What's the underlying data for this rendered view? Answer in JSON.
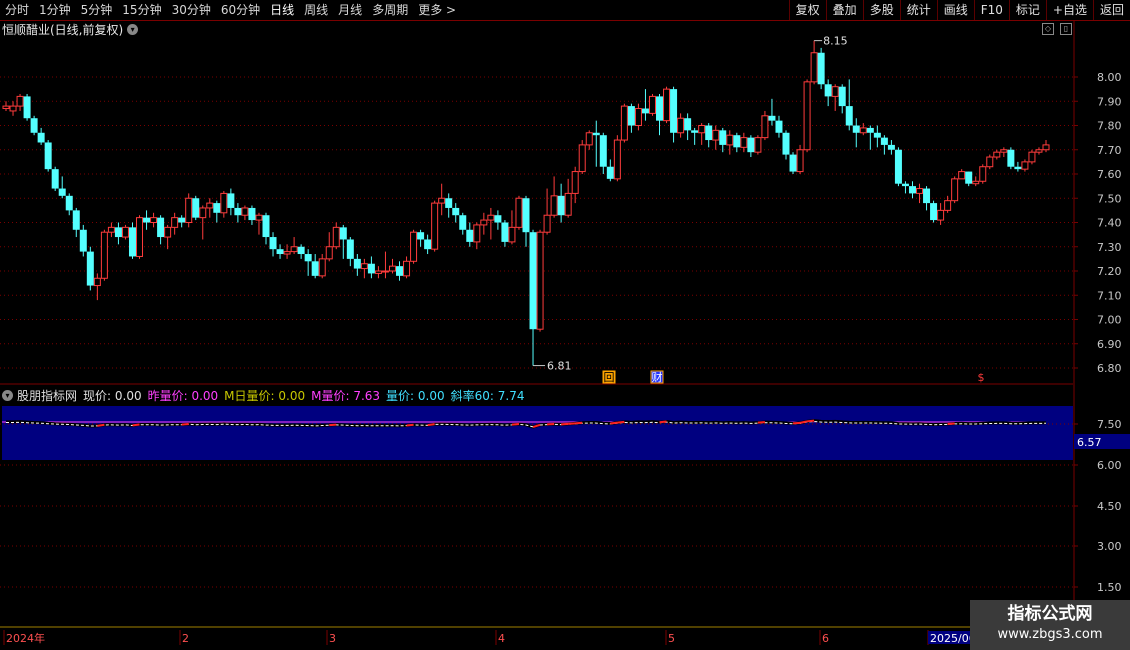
{
  "toolbar": {
    "periods": [
      "分时",
      "1分钟",
      "5分钟",
      "15分钟",
      "30分钟",
      "60分钟",
      "日线",
      "周线",
      "月线",
      "多周期",
      "更多 >"
    ],
    "active_period": "日线",
    "actions": [
      "复权",
      "叠加",
      "多股",
      "统计",
      "画线",
      "F10",
      "标记",
      "+自选",
      "返回"
    ]
  },
  "stock_title": "恒顺醋业(日线,前复权)",
  "main_chart": {
    "high_label": "8.15",
    "low_label": "6.81",
    "y_ticks": [
      "8.00",
      "7.90",
      "7.80",
      "7.70",
      "7.60",
      "7.50",
      "7.40",
      "7.30",
      "7.20",
      "7.10",
      "7.00",
      "6.90",
      "6.80"
    ],
    "markers": [
      "回",
      "财",
      "$"
    ]
  },
  "indicator": {
    "name": "股朋指标网",
    "fields": [
      {
        "label": "现价: 0.00",
        "color": "#e0e0e0"
      },
      {
        "label": "昨量价: 0.00",
        "color": "#ff40ff"
      },
      {
        "label": "M日量价: 0.00",
        "color": "#c8c800"
      },
      {
        "label": "M量价: 7.63",
        "color": "#ff40ff"
      },
      {
        "label": "量价: 0.00",
        "color": "#40e0ff"
      },
      {
        "label": "斜率60: 7.74",
        "color": "#40e0ff"
      }
    ],
    "y_ticks": [
      "7.50",
      "6.00",
      "4.50",
      "3.00",
      "1.50"
    ],
    "current_value": "6.57"
  },
  "x_axis": {
    "labels": [
      "2024年",
      "2",
      "3",
      "4",
      "5",
      "6",
      "2025/06"
    ]
  },
  "watermark": {
    "line1": "指标公式网",
    "line2": "www.zbgs3.com"
  },
  "colors": {
    "up": "#ff3c3c",
    "down": "#54ffff",
    "grid": "#7a0000",
    "panel_bg": "#000080"
  },
  "chart_data": {
    "type": "candlestick",
    "candles": [
      [
        7.87,
        7.88,
        7.86,
        7.9
      ],
      [
        7.86,
        7.88,
        7.84,
        7.9
      ],
      [
        7.88,
        7.92,
        7.86,
        7.93
      ],
      [
        7.92,
        7.83,
        7.82,
        7.93
      ],
      [
        7.83,
        7.77,
        7.76,
        7.84
      ],
      [
        7.77,
        7.73,
        7.72,
        7.79
      ],
      [
        7.73,
        7.62,
        7.61,
        7.74
      ],
      [
        7.62,
        7.54,
        7.53,
        7.63
      ],
      [
        7.54,
        7.51,
        7.5,
        7.59
      ],
      [
        7.51,
        7.45,
        7.43,
        7.52
      ],
      [
        7.45,
        7.37,
        7.34,
        7.46
      ],
      [
        7.37,
        7.28,
        7.26,
        7.39
      ],
      [
        7.28,
        7.14,
        7.12,
        7.3
      ],
      [
        7.14,
        7.17,
        7.08,
        7.19
      ],
      [
        7.17,
        7.36,
        7.16,
        7.37
      ],
      [
        7.36,
        7.38,
        7.34,
        7.4
      ],
      [
        7.38,
        7.34,
        7.31,
        7.4
      ],
      [
        7.34,
        7.38,
        7.33,
        7.39
      ],
      [
        7.38,
        7.26,
        7.25,
        7.4
      ],
      [
        7.26,
        7.42,
        7.25,
        7.43
      ],
      [
        7.42,
        7.4,
        7.37,
        7.45
      ],
      [
        7.4,
        7.42,
        7.38,
        7.44
      ],
      [
        7.42,
        7.34,
        7.31,
        7.43
      ],
      [
        7.34,
        7.38,
        7.29,
        7.39
      ],
      [
        7.38,
        7.42,
        7.35,
        7.44
      ],
      [
        7.42,
        7.4,
        7.38,
        7.43
      ],
      [
        7.4,
        7.5,
        7.38,
        7.52
      ],
      [
        7.5,
        7.42,
        7.41,
        7.51
      ],
      [
        7.42,
        7.46,
        7.33,
        7.47
      ],
      [
        7.46,
        7.48,
        7.42,
        7.5
      ],
      [
        7.48,
        7.44,
        7.4,
        7.49
      ],
      [
        7.44,
        7.52,
        7.42,
        7.53
      ],
      [
        7.52,
        7.46,
        7.43,
        7.54
      ],
      [
        7.46,
        7.43,
        7.4,
        7.48
      ],
      [
        7.43,
        7.46,
        7.41,
        7.47
      ],
      [
        7.46,
        7.41,
        7.39,
        7.47
      ],
      [
        7.41,
        7.43,
        7.35,
        7.44
      ],
      [
        7.43,
        7.34,
        7.31,
        7.44
      ],
      [
        7.34,
        7.29,
        7.26,
        7.36
      ],
      [
        7.29,
        7.27,
        7.25,
        7.31
      ],
      [
        7.27,
        7.28,
        7.25,
        7.31
      ],
      [
        7.28,
        7.3,
        7.27,
        7.34
      ],
      [
        7.3,
        7.27,
        7.25,
        7.31
      ],
      [
        7.27,
        7.24,
        7.18,
        7.29
      ],
      [
        7.24,
        7.18,
        7.17,
        7.27
      ],
      [
        7.18,
        7.25,
        7.17,
        7.27
      ],
      [
        7.25,
        7.3,
        7.24,
        7.36
      ],
      [
        7.3,
        7.38,
        7.29,
        7.4
      ],
      [
        7.38,
        7.33,
        7.25,
        7.39
      ],
      [
        7.33,
        7.25,
        7.22,
        7.34
      ],
      [
        7.25,
        7.21,
        7.18,
        7.27
      ],
      [
        7.21,
        7.23,
        7.17,
        7.25
      ],
      [
        7.23,
        7.19,
        7.17,
        7.26
      ],
      [
        7.19,
        7.2,
        7.17,
        7.22
      ],
      [
        7.2,
        7.2,
        7.17,
        7.28
      ],
      [
        7.2,
        7.22,
        7.19,
        7.25
      ],
      [
        7.22,
        7.18,
        7.16,
        7.24
      ],
      [
        7.18,
        7.24,
        7.17,
        7.26
      ],
      [
        7.24,
        7.36,
        7.23,
        7.37
      ],
      [
        7.36,
        7.33,
        7.3,
        7.37
      ],
      [
        7.33,
        7.29,
        7.27,
        7.35
      ],
      [
        7.29,
        7.48,
        7.28,
        7.49
      ],
      [
        7.48,
        7.5,
        7.43,
        7.56
      ],
      [
        7.5,
        7.46,
        7.42,
        7.52
      ],
      [
        7.46,
        7.43,
        7.4,
        7.48
      ],
      [
        7.43,
        7.37,
        7.35,
        7.44
      ],
      [
        7.37,
        7.32,
        7.3,
        7.4
      ],
      [
        7.32,
        7.39,
        7.29,
        7.4
      ],
      [
        7.39,
        7.41,
        7.35,
        7.44
      ],
      [
        7.41,
        7.43,
        7.33,
        7.46
      ],
      [
        7.43,
        7.4,
        7.37,
        7.45
      ],
      [
        7.4,
        7.32,
        7.3,
        7.41
      ],
      [
        7.32,
        7.38,
        7.31,
        7.45
      ],
      [
        7.38,
        7.5,
        7.37,
        7.51
      ],
      [
        7.5,
        7.36,
        7.3,
        7.51
      ],
      [
        7.36,
        6.96,
        6.81,
        7.37
      ],
      [
        6.96,
        7.36,
        6.95,
        7.37
      ],
      [
        7.36,
        7.43,
        7.35,
        7.54
      ],
      [
        7.43,
        7.51,
        7.42,
        7.59
      ],
      [
        7.51,
        7.43,
        7.4,
        7.56
      ],
      [
        7.43,
        7.52,
        7.42,
        7.58
      ],
      [
        7.52,
        7.61,
        7.48,
        7.63
      ],
      [
        7.61,
        7.72,
        7.6,
        7.74
      ],
      [
        7.72,
        7.77,
        7.7,
        7.78
      ],
      [
        7.77,
        7.76,
        7.63,
        7.82
      ],
      [
        7.76,
        7.63,
        7.6,
        7.77
      ],
      [
        7.63,
        7.58,
        7.57,
        7.66
      ],
      [
        7.58,
        7.74,
        7.57,
        7.76
      ],
      [
        7.74,
        7.88,
        7.73,
        7.89
      ],
      [
        7.88,
        7.8,
        7.77,
        7.89
      ],
      [
        7.8,
        7.87,
        7.78,
        7.89
      ],
      [
        7.87,
        7.85,
        7.82,
        7.95
      ],
      [
        7.85,
        7.92,
        7.84,
        7.93
      ],
      [
        7.92,
        7.82,
        7.76,
        7.93
      ],
      [
        7.82,
        7.95,
        7.81,
        7.96
      ],
      [
        7.95,
        7.77,
        7.73,
        7.96
      ],
      [
        7.77,
        7.83,
        7.75,
        7.85
      ],
      [
        7.83,
        7.78,
        7.74,
        7.85
      ],
      [
        7.78,
        7.77,
        7.72,
        7.79
      ],
      [
        7.77,
        7.8,
        7.72,
        7.81
      ],
      [
        7.8,
        7.74,
        7.71,
        7.81
      ],
      [
        7.74,
        7.78,
        7.7,
        7.8
      ],
      [
        7.78,
        7.72,
        7.69,
        7.79
      ],
      [
        7.72,
        7.76,
        7.68,
        7.78
      ],
      [
        7.76,
        7.71,
        7.69,
        7.77
      ],
      [
        7.71,
        7.75,
        7.69,
        7.77
      ],
      [
        7.75,
        7.69,
        7.67,
        7.76
      ],
      [
        7.69,
        7.75,
        7.68,
        7.76
      ],
      [
        7.75,
        7.84,
        7.74,
        7.86
      ],
      [
        7.84,
        7.82,
        7.8,
        7.91
      ],
      [
        7.82,
        7.77,
        7.75,
        7.84
      ],
      [
        7.77,
        7.68,
        7.66,
        7.78
      ],
      [
        7.68,
        7.61,
        7.6,
        7.69
      ],
      [
        7.61,
        7.7,
        7.6,
        7.72
      ],
      [
        7.7,
        7.98,
        7.69,
        7.99
      ],
      [
        7.98,
        8.1,
        7.97,
        8.15
      ],
      [
        8.1,
        7.97,
        7.95,
        8.12
      ],
      [
        7.97,
        7.92,
        7.88,
        7.99
      ],
      [
        7.92,
        7.96,
        7.86,
        7.97
      ],
      [
        7.96,
        7.88,
        7.85,
        7.97
      ],
      [
        7.88,
        7.8,
        7.78,
        7.99
      ],
      [
        7.8,
        7.77,
        7.71,
        7.83
      ],
      [
        7.77,
        7.79,
        7.76,
        7.81
      ],
      [
        7.79,
        7.77,
        7.7,
        7.8
      ],
      [
        7.77,
        7.75,
        7.71,
        7.8
      ],
      [
        7.75,
        7.72,
        7.68,
        7.76
      ],
      [
        7.72,
        7.7,
        7.68,
        7.74
      ],
      [
        7.7,
        7.56,
        7.55,
        7.71
      ],
      [
        7.56,
        7.55,
        7.52,
        7.57
      ],
      [
        7.55,
        7.52,
        7.5,
        7.57
      ],
      [
        7.52,
        7.54,
        7.48,
        7.56
      ],
      [
        7.54,
        7.48,
        7.45,
        7.55
      ],
      [
        7.48,
        7.41,
        7.4,
        7.49
      ],
      [
        7.41,
        7.45,
        7.39,
        7.48
      ],
      [
        7.45,
        7.49,
        7.44,
        7.51
      ],
      [
        7.49,
        7.58,
        7.48,
        7.59
      ],
      [
        7.58,
        7.61,
        7.58,
        7.62
      ],
      [
        7.61,
        7.56,
        7.55,
        7.61
      ],
      [
        7.56,
        7.57,
        7.55,
        7.59
      ],
      [
        7.57,
        7.63,
        7.56,
        7.64
      ],
      [
        7.63,
        7.67,
        7.62,
        7.68
      ],
      [
        7.67,
        7.69,
        7.66,
        7.7
      ],
      [
        7.69,
        7.7,
        7.67,
        7.71
      ],
      [
        7.7,
        7.63,
        7.62,
        7.71
      ],
      [
        7.63,
        7.62,
        7.61,
        7.65
      ],
      [
        7.62,
        7.65,
        7.61,
        7.66
      ],
      [
        7.65,
        7.69,
        7.64,
        7.7
      ],
      [
        7.69,
        7.7,
        7.68,
        7.71
      ],
      [
        7.7,
        7.72,
        7.69,
        7.74
      ]
    ],
    "ylim": [
      6.78,
      8.22
    ]
  }
}
